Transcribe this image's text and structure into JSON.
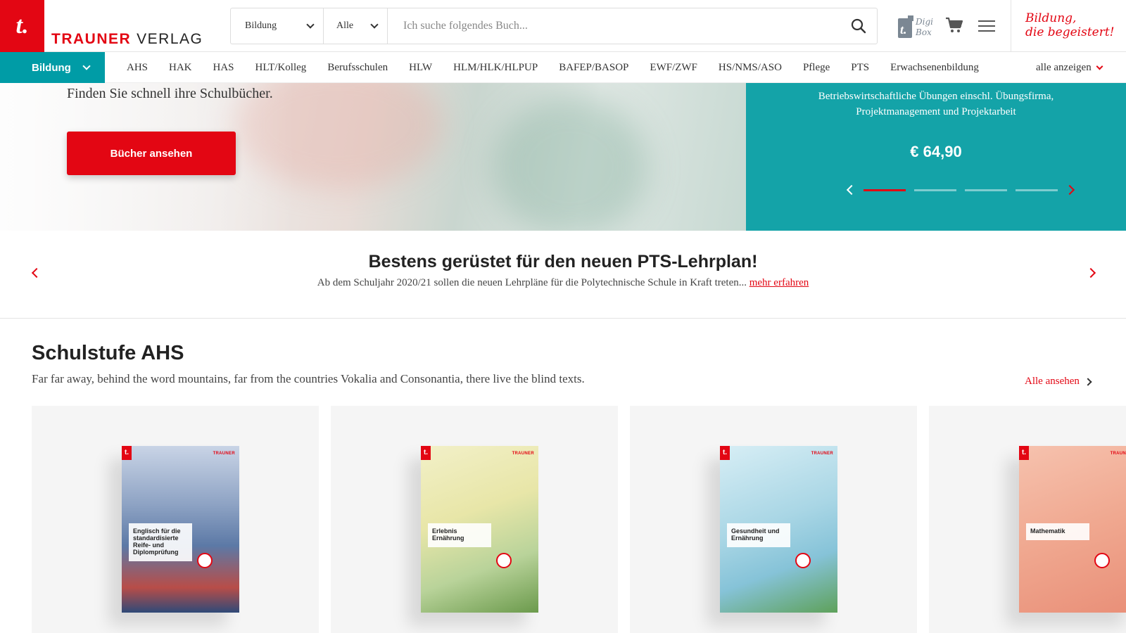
{
  "header": {
    "logo_letter": "t.",
    "logo_brand": "TRAUNER",
    "logo_rest": "VERLAG",
    "search": {
      "category_select": "Bildung",
      "type_select": "Alle",
      "placeholder": "Ich suche folgendes Buch..."
    },
    "digibox_label": "DigiBox",
    "slogan_line1": "Bildung,",
    "slogan_line2": "die begeistert!"
  },
  "nav": {
    "active": "Bildung",
    "items": [
      "AHS",
      "HAK",
      "HAS",
      "HLT/Kolleg",
      "Berufsschulen",
      "HLW",
      "HLM/HLK/HLPUP",
      "BAFEP/BASOP",
      "EWF/ZWF",
      "HS/NMS/ASO",
      "Pflege",
      "PTS",
      "Erwachsenenbildung"
    ],
    "more": "alle anzeigen"
  },
  "hero": {
    "subtitle": "Finden Sie schnell ihre Schulbücher.",
    "button": "Bücher ansehen"
  },
  "teaser": {
    "text": "Betriebswirtschaftliche Übungen einschl. Übungsfirma, Projektmanagement und Projektarbeit",
    "price": "€ 64,90",
    "slides": 4,
    "active_slide": 1
  },
  "announcement": {
    "title": "Bestens gerüstet für den neuen PTS-Lehrplan!",
    "text": "Ab dem Schuljahr 2020/21 sollen die neuen Lehrpläne für die Polytechnische Schule in Kraft treten...",
    "link": "mehr erfahren"
  },
  "section": {
    "title": "Schulstufe AHS",
    "description": "Far far away, behind the word mountains, far from the countries Vokalia and Consonantia, there live the blind texts.",
    "all_link": "Alle ansehen",
    "books": [
      {
        "title": "Englisch für die standardisierte Reife- und Diplomprüfung",
        "color": "#8aa0c2"
      },
      {
        "title": "Erlebnis Ernährung",
        "color": "#e6e7b4"
      },
      {
        "title": "Gesundheit und Ernährung",
        "color": "#a9d6e5"
      },
      {
        "title": "Mathematik",
        "color": "#f0a890"
      }
    ]
  },
  "colors": {
    "accent": "#e30613",
    "teal": "#009ca6",
    "teaser_bg": "#14a3a8"
  }
}
